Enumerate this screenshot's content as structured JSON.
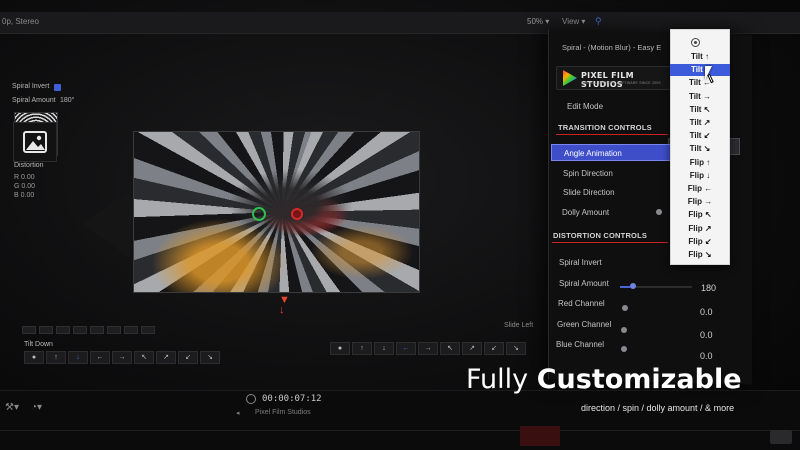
{
  "top_bar": {
    "resolution": "0p, Stereo",
    "zoom": "50% ▾",
    "view": "View ▾",
    "mark": "⚲"
  },
  "left_params": {
    "spiral_invert": "Spiral Invert",
    "spiral_amount": "Spiral Amount",
    "spiral_amount_value": "180°",
    "distortion": "Distortion",
    "r": "R  0.00",
    "g": "G  0.00",
    "b": "B  0.00"
  },
  "bottom_strip": {
    "tilt_down": "Tilt Down",
    "slide_left": "Slide Left",
    "buttons_left": [
      "●",
      "↑",
      "↓",
      "←",
      "→",
      "↖",
      "↗",
      "↙",
      "↘"
    ],
    "buttons_right": [
      "●",
      "↑",
      "↓",
      "←",
      "→",
      "↖",
      "↗",
      "↙",
      "↘"
    ]
  },
  "timeline": {
    "timecode": "00:00:07:12",
    "studio": "Pixel Film Studios"
  },
  "panel": {
    "title": "Spiral - (Motion Blur) - Easy E",
    "logo_title": "PIXEL FILM STUDIOS",
    "logo_sub": "SPECIAL EFFECTS SOFTWARE SINCE 2009",
    "edit_mode": "Edit Mode",
    "transition_controls": "TRANSITION CONTROLS",
    "angle_animation": "Angle Animation",
    "spin_direction": "Spin Direction",
    "slide_direction": "Slide Direction",
    "dolly_amount": "Dolly Amount",
    "distortion_controls": "DISTORTION CONTROLS",
    "spiral_invert": "Spiral Invert",
    "spiral_amount": "Spiral Amount",
    "spiral_amount_value": "180",
    "red_channel": "Red Channel",
    "red_value": "0.0",
    "green_channel": "Green Channel",
    "green_value": "0.0",
    "blue_channel": "Blue Channel",
    "blue_value": "0.0"
  },
  "dropdown": {
    "selected_index": 1,
    "items": [
      "Tilt ↑",
      "Tilt ↓",
      "Tilt ←",
      "Tilt →",
      "Tilt ↖",
      "Tilt ↗",
      "Tilt ↙",
      "Tilt ↘",
      "Flip ↑",
      "Flip ↓",
      "Flip ←",
      "Flip →",
      "Flip ↖",
      "Flip ↗",
      "Flip ↙",
      "Flip ↘"
    ]
  },
  "caption": {
    "title_light": "Fully ",
    "title_bold": "Customizable",
    "subtitle": "direction / spin / dolly amount / & more"
  },
  "colors": {
    "accent": "#3b5bdb",
    "handle_green": "#2fbf4f",
    "handle_red": "#d32b2b"
  }
}
